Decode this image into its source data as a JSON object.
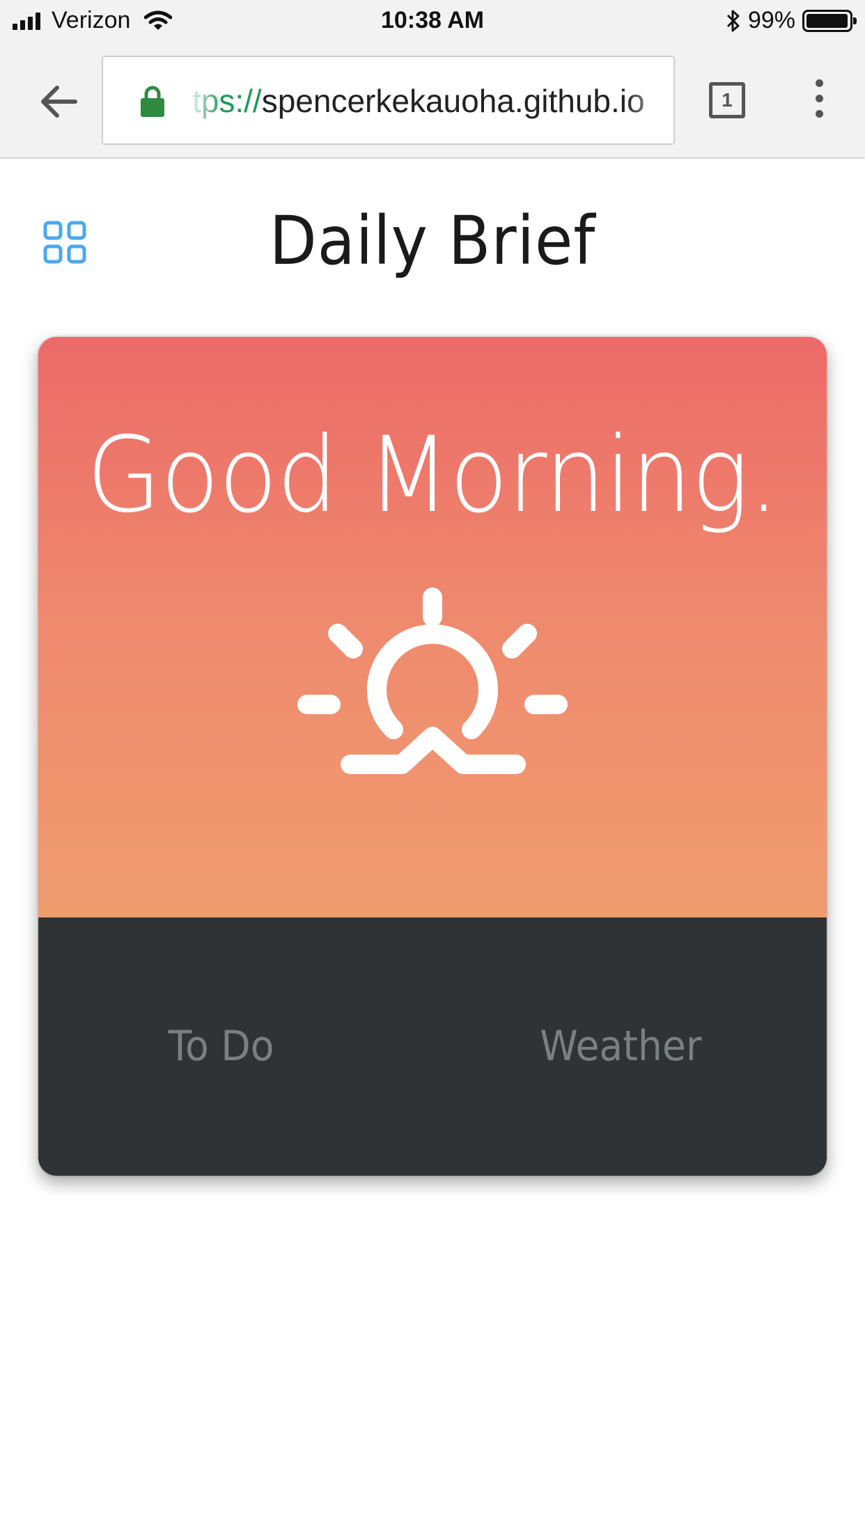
{
  "status_bar": {
    "carrier": "Verizon",
    "time": "10:38 AM",
    "battery_percent": "99%",
    "battery_level": 0.99,
    "icons": [
      "signal-icon",
      "wifi-icon",
      "bluetooth-icon",
      "battery-icon"
    ]
  },
  "browser": {
    "url_scheme": "tps://",
    "url_host": "spencerkekauoha.github.io",
    "tab_count": "1",
    "icons": [
      "back-arrow-icon",
      "lock-icon",
      "tabs-icon",
      "overflow-menu-icon"
    ]
  },
  "header": {
    "title": "Daily Brief",
    "menu_icon": "grid-icon"
  },
  "card": {
    "greeting": "Good Morning.",
    "weather_icon": "sunrise-icon",
    "tabs": [
      {
        "label": "To Do"
      },
      {
        "label": "Weather"
      }
    ]
  },
  "colors": {
    "gradient_top": "#ec6a68",
    "gradient_bottom": "#f09c6f",
    "card_footer": "#2f3335",
    "accent_blue": "#4aa8f0",
    "lock_green": "#2e8b3e"
  }
}
